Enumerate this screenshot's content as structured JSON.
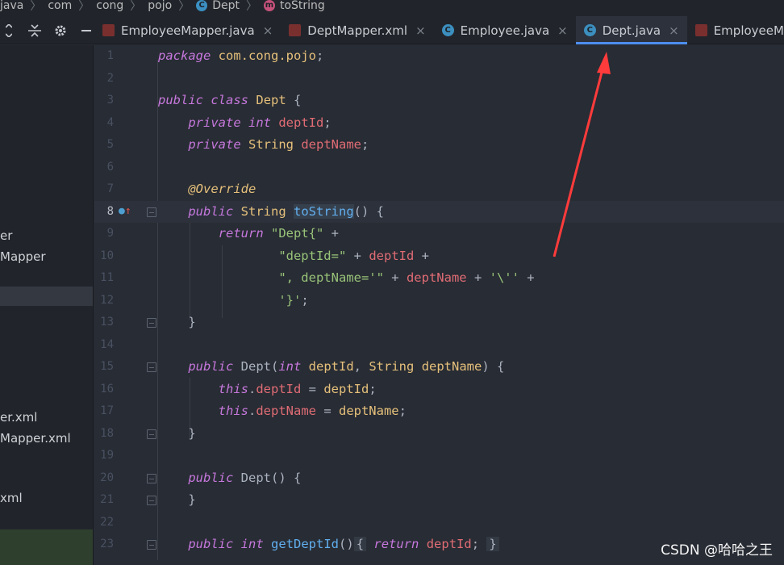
{
  "breadcrumb": {
    "items": [
      "java",
      "com",
      "cong",
      "pojo",
      "Dept",
      "toString"
    ]
  },
  "tabs": [
    {
      "label": "EmployeeMapper.java",
      "icon": "mybatis-bird-icon"
    },
    {
      "label": "DeptMapper.xml",
      "icon": "mybatis-bird-icon"
    },
    {
      "label": "Employee.java",
      "icon": "class-icon"
    },
    {
      "label": "Dept.java",
      "icon": "class-icon",
      "active": true
    },
    {
      "label": "EmployeeMapp",
      "icon": "mybatis-bird-icon"
    }
  ],
  "sidebar": {
    "items": [
      "er",
      "Mapper",
      "er.xml",
      "Mapper.xml",
      "xml"
    ]
  },
  "editor": {
    "line_numbers": [
      "1",
      "2",
      "3",
      "4",
      "5",
      "6",
      "7",
      "8",
      "9",
      "10",
      "11",
      "12",
      "13",
      "14",
      "15",
      "16",
      "17",
      "18",
      "19",
      "20",
      "21",
      "22",
      "23"
    ],
    "current_line": "8"
  },
  "watermark": "CSDN @哈哈之王",
  "colors": {
    "keyword": "#c678dd",
    "type": "#e5c07b",
    "field": "#e06c75",
    "string": "#98c379",
    "function": "#61afef",
    "arrow": "#ff3b3b",
    "active_tab_underline": "#4d8ef0"
  }
}
